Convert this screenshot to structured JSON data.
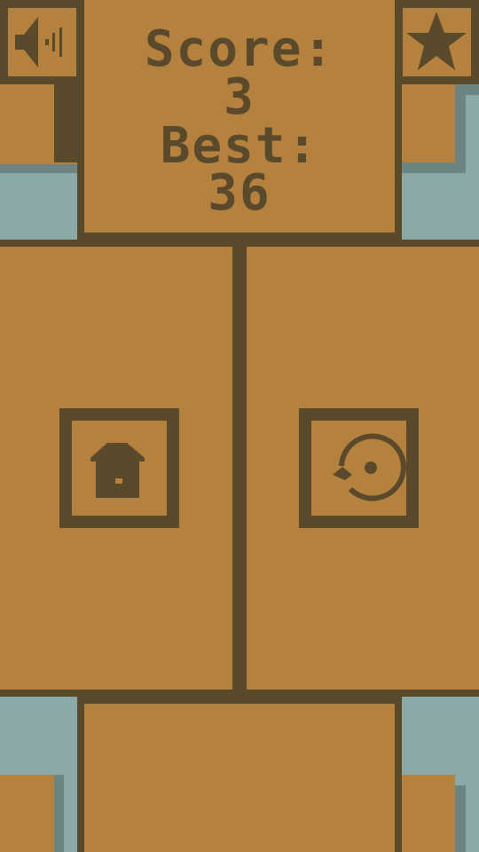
{
  "hud": {
    "score_label": "Score:",
    "score_value": "3",
    "best_label": "Best:",
    "best_value": "36"
  },
  "buttons": {
    "sound_icon": "speaker-icon",
    "rate_icon": "star-icon",
    "home_icon": "home-icon",
    "restart_icon": "restart-icon"
  },
  "colors": {
    "background": "#b5813e",
    "frame": "#5a4a2b",
    "water": "#8aa9a7",
    "water_shadow": "#6c8583"
  }
}
